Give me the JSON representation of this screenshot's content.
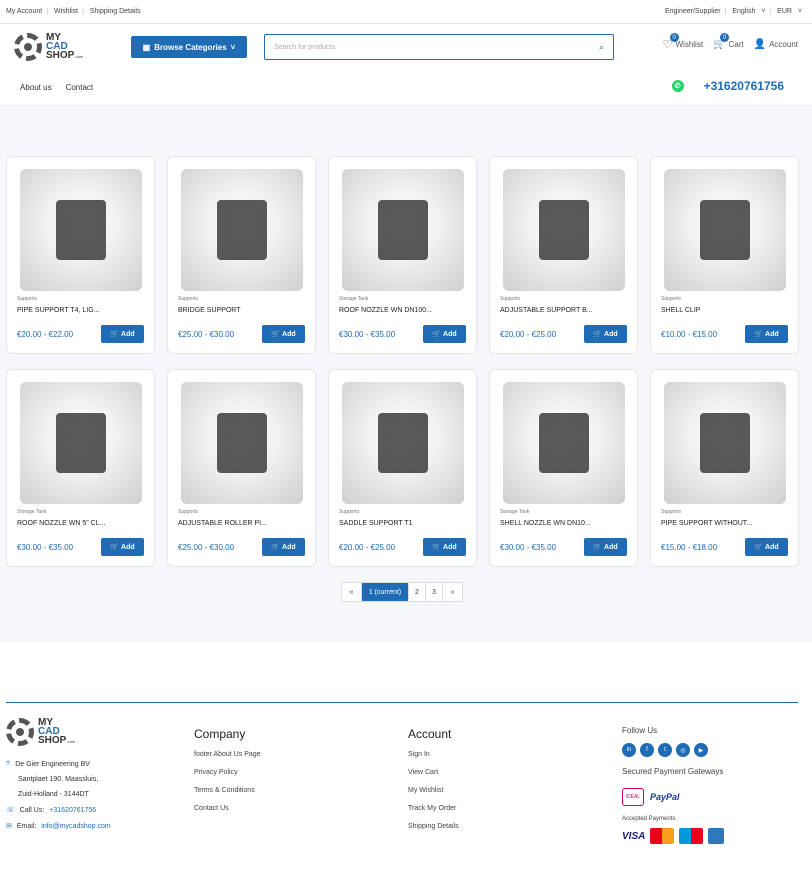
{
  "topbar": {
    "left": [
      "My Account",
      "Wishlist",
      "Shipping Details"
    ],
    "right": [
      "Engineer/Supplier",
      "English",
      "EUR"
    ]
  },
  "logo": {
    "line1": "MY",
    "line2": "CAD",
    "line3": "SHOP",
    "suffix": ".com"
  },
  "header": {
    "browse": "Browse Categories",
    "search_placeholder": "Search for products",
    "wishlist": "Wishlist",
    "wishlist_count": "0",
    "cart": "Cart",
    "cart_count": "0",
    "account": "Account"
  },
  "nav": {
    "items": [
      "About us",
      "Contact"
    ],
    "phone": "+31620761756"
  },
  "products": [
    {
      "cat": "Supports",
      "name": "PIPE SUPPORT T4, LIG...",
      "price": "€20.00 - €22.00",
      "add": "Add"
    },
    {
      "cat": "Supports",
      "name": "BRIDGE SUPPORT",
      "price": "€25.00 - €30.00",
      "add": "Add"
    },
    {
      "cat": "Storage Tank",
      "name": "ROOF NOZZLE WN DN100...",
      "price": "€30.00 - €35.00",
      "add": "Add"
    },
    {
      "cat": "Supports",
      "name": "ADJUSTABLE SUPPORT B...",
      "price": "€20.00 - €25.00",
      "add": "Add"
    },
    {
      "cat": "Supports",
      "name": "SHELL CLIP",
      "price": "€10.00 - €15.00",
      "add": "Add"
    },
    {
      "cat": "Storage Tank",
      "name": "ROOF NOZZLE WN 5\" CL...",
      "price": "€30.00 - €35.00",
      "add": "Add"
    },
    {
      "cat": "Supports",
      "name": "ADJUSTABLE ROLLER PI...",
      "price": "€25.00 - €30.00",
      "add": "Add"
    },
    {
      "cat": "Supports",
      "name": "SADDLE SUPPORT T1",
      "price": "€20.00 - €25.00",
      "add": "Add"
    },
    {
      "cat": "Storage Tank",
      "name": "SHELL NOZZLE WN DN10...",
      "price": "€30.00 - €35.00",
      "add": "Add"
    },
    {
      "cat": "Supports",
      "name": "PIPE SUPPORT WITHOUT...",
      "price": "€15.00 - €18.00",
      "add": "Add"
    }
  ],
  "pager": {
    "first": "«",
    "current": "1 (current)",
    "p2": "2",
    "p3": "3",
    "last": "»"
  },
  "footer": {
    "address": {
      "company": "De Gier Engineering BV",
      "street": "Santplaet 190, Maassluis,",
      "city": "Zuid-Holland - 3144DT",
      "call_label": "Call Us:",
      "call": "+31620761756",
      "email_label": "Email:",
      "email": "info@mycadshop.com"
    },
    "company": {
      "title": "Company",
      "links": [
        "footer.About Us Page",
        "Privacy Policy",
        "Terms & Conditions",
        "Contact Us"
      ]
    },
    "account": {
      "title": "Account",
      "links": [
        "Sign In",
        "View Cart",
        "My Wishlist",
        "Track My Order",
        "Shipping Details"
      ]
    },
    "follow": {
      "title": "Follow Us",
      "icons": [
        "in",
        "f",
        "t",
        "◎",
        "▶"
      ]
    },
    "gateways": "Secured Payment Gateways",
    "ideal": "iDEAL",
    "paypal": "PayPal",
    "accepted": "Accepted Payments",
    "visa": "VISA"
  }
}
